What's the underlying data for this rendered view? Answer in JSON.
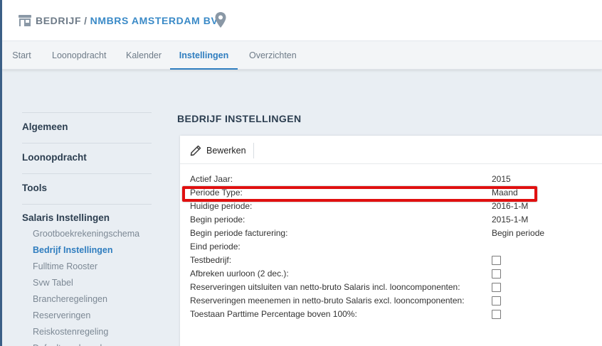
{
  "header": {
    "section": "BEDRIJF",
    "separator": "/",
    "company": "NMBRS AMSTERDAM BV"
  },
  "nav": {
    "tabs": [
      {
        "label": "Start",
        "active": false
      },
      {
        "label": "Loonopdracht",
        "active": false
      },
      {
        "label": "Kalender",
        "active": false
      },
      {
        "label": "Instellingen",
        "active": true
      },
      {
        "label": "Overzichten",
        "active": false
      }
    ]
  },
  "sidebar": {
    "sections": [
      "Algemeen",
      "Loonopdracht",
      "Tools",
      "Salaris Instellingen"
    ],
    "items": [
      {
        "label": "Grootboekrekeningschema",
        "active": false
      },
      {
        "label": "Bedrijf Instellingen",
        "active": true
      },
      {
        "label": "Fulltime Rooster",
        "active": false
      },
      {
        "label": "Svw Tabel",
        "active": false
      },
      {
        "label": "Brancheregelingen",
        "active": false
      },
      {
        "label": "Reserveringen",
        "active": false
      },
      {
        "label": "Reiskostenregeling",
        "active": false
      },
      {
        "label": "Default medewerker",
        "active": false
      }
    ]
  },
  "main": {
    "title": "BEDRIJF INSTELLINGEN",
    "edit_label": "Bewerken",
    "rows": [
      {
        "label": "Actief Jaar:",
        "value": "2015"
      },
      {
        "label": "Periode Type:",
        "value": "Maand"
      },
      {
        "label": "Huidige periode:",
        "value": "2016-1-M"
      },
      {
        "label": "Begin periode:",
        "value": "2015-1-M"
      },
      {
        "label": "Begin periode facturering:",
        "value": "Begin periode"
      },
      {
        "label": "Eind periode:",
        "value": ""
      },
      {
        "label": "Testbedrijf:",
        "checked": false
      },
      {
        "label": "Afbreken uurloon (2 dec.):",
        "checked": false
      },
      {
        "label": "Reserveringen uitsluiten van netto-bruto Salaris incl. looncomponenten:",
        "checked": false
      },
      {
        "label": "Reserveringen meenemen in netto-bruto Salaris excl. looncomponenten:",
        "checked": false
      },
      {
        "label": "Toestaan Parttime Percentage boven 100%:",
        "checked": false
      }
    ]
  },
  "annotation": {
    "highlighted_row": "Periode Type:",
    "color": "#e01010"
  },
  "colors": {
    "accent": "#2f7dbf",
    "nav_bg": "#f3f5f7",
    "page_bg": "#e9eef3",
    "dark_bar": "#3b5f86"
  },
  "icons": {
    "header_left": "building-icon",
    "header_right": "location-pin-icon",
    "edit": "pencil-icon"
  }
}
